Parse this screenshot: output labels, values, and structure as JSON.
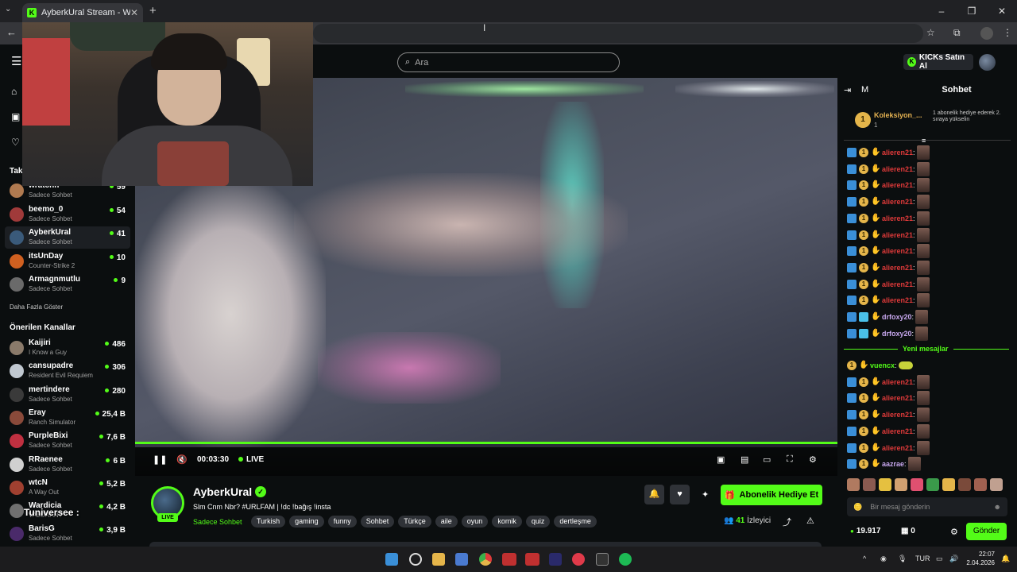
{
  "browser": {
    "tab_title": "AyberkUral Stream - Watch Live",
    "tab_favicon": "K",
    "new_tab": "+",
    "window_controls": [
      "–",
      "❐",
      "✕"
    ]
  },
  "header": {
    "search_placeholder": "Ara",
    "kicks_label": "KICKs Satın Al"
  },
  "sidebar": {
    "following_title": "Takip",
    "following": [
      {
        "name": "wratchn",
        "sub": "Sadece Sohbet",
        "viewers": "59",
        "color": "#b07a50"
      },
      {
        "name": "beemo_0",
        "sub": "Sadece Sohbet",
        "viewers": "54",
        "color": "#a03a3a"
      },
      {
        "name": "AyberkUral",
        "sub": "Sadece Sohbet",
        "viewers": "41",
        "color": "#3a5a7a"
      },
      {
        "name": "itsUnDay",
        "sub": "Counter-Strike 2",
        "viewers": "10",
        "color": "#d06020"
      },
      {
        "name": "Armagnmutlu",
        "sub": "Sadece Sohbet",
        "viewers": "9",
        "color": "#6a6a6a"
      }
    ],
    "show_more": "Daha Fazla Göster",
    "recommended_title": "Önerilen Kanallar",
    "recommended": [
      {
        "name": "Kaijiri",
        "sub": "I Know a Guy",
        "viewers": "486",
        "color": "#8a7a6a"
      },
      {
        "name": "cansupadre",
        "sub": "Resident Evil Requiem",
        "viewers": "306",
        "color": "#c0c8d0"
      },
      {
        "name": "mertindere",
        "sub": "Sadece Sohbet",
        "viewers": "280",
        "color": "#3a3a3a"
      },
      {
        "name": "Eray",
        "sub": "Ranch Simulator",
        "viewers": "25,4 B",
        "color": "#8a4a3a"
      },
      {
        "name": "PurpleBixi",
        "sub": "Sadece Sohbet",
        "viewers": "7,6 B",
        "color": "#c03040"
      },
      {
        "name": "RRaenee",
        "sub": "Sadece Sohbet",
        "viewers": "6 B",
        "color": "#d0d0d0"
      },
      {
        "name": "wtcN",
        "sub": "A Way Out",
        "viewers": "5,2 B",
        "color": "#a04030"
      },
      {
        "name": "Wardicia",
        "sub": "VALORANT",
        "viewers": "4,2 B",
        "color": "#707070"
      },
      {
        "name": "BarisG",
        "sub": "Sadece Sohbet",
        "viewers": "3,9 B",
        "color": "#4a2a6a"
      }
    ]
  },
  "overlay_text": "Tuniversee :",
  "player": {
    "time": "00:03:30",
    "live": "LIVE"
  },
  "stream": {
    "name": "AyberkUral",
    "title": "Slm Cnm Nbr? #URLFAM  | !dc !bağış !insta",
    "category": "Sadece Sohbet",
    "tags": [
      "Turkish",
      "gaming",
      "funny",
      "Sohbet",
      "Türkçe",
      "aile",
      "oyun",
      "komik",
      "quiz",
      "dertleşme"
    ],
    "live_badge": "LIVE",
    "gift_button": "Abonelik Hediye Et",
    "viewers_count": "41",
    "viewers_label": "İzleyici"
  },
  "chat": {
    "title": "Sohbet",
    "header_m": "M",
    "pinned_name": "Koleksiyon_...",
    "pinned_sub": "1",
    "pinned_rank": "1",
    "pinned_gift_text": "1 abonelik hediye ederek 2. sıraya yükselin",
    "new_messages": "Yeni mesajlar",
    "messages": [
      {
        "user": "alieren21",
        "color": "#e03a3a",
        "badges": [
          "b1",
          "b2",
          "b3"
        ],
        "emote": "face"
      },
      {
        "user": "alieren21",
        "color": "#e03a3a",
        "badges": [
          "b1",
          "b2",
          "b3"
        ],
        "emote": "face"
      },
      {
        "user": "alieren21",
        "color": "#e03a3a",
        "badges": [
          "b1",
          "b2",
          "b3"
        ],
        "emote": "face"
      },
      {
        "user": "alieren21",
        "color": "#e03a3a",
        "badges": [
          "b1",
          "b2",
          "b3"
        ],
        "emote": "face"
      },
      {
        "user": "alieren21",
        "color": "#e03a3a",
        "badges": [
          "b1",
          "b2",
          "b3"
        ],
        "emote": "face"
      },
      {
        "user": "alieren21",
        "color": "#e03a3a",
        "badges": [
          "b1",
          "b2",
          "b3"
        ],
        "emote": "face"
      },
      {
        "user": "alieren21",
        "color": "#e03a3a",
        "badges": [
          "b1",
          "b2",
          "b3"
        ],
        "emote": "face"
      },
      {
        "user": "alieren21",
        "color": "#e03a3a",
        "badges": [
          "b1",
          "b2",
          "b3"
        ],
        "emote": "face"
      },
      {
        "user": "alieren21",
        "color": "#e03a3a",
        "badges": [
          "b1",
          "b2",
          "b3"
        ],
        "emote": "face"
      },
      {
        "user": "alieren21",
        "color": "#e03a3a",
        "badges": [
          "b1",
          "b2",
          "b3"
        ],
        "emote": "face"
      },
      {
        "user": "drfoxy20",
        "color": "#c8a8f0",
        "badges": [
          "b1",
          "b4",
          "b3"
        ],
        "emote": "face"
      },
      {
        "user": "drfoxy20",
        "color": "#c8a8f0",
        "badges": [
          "b1",
          "b4",
          "b3"
        ],
        "emote": "face"
      }
    ],
    "messages_new": [
      {
        "user": "vuencx",
        "color": "#53fc18",
        "badges": [
          "b2",
          "b3"
        ],
        "emote": "frog"
      },
      {
        "user": "alieren21",
        "color": "#e03a3a",
        "badges": [
          "b1",
          "b2",
          "b3"
        ],
        "emote": "face"
      },
      {
        "user": "alieren21",
        "color": "#e03a3a",
        "badges": [
          "b1",
          "b2",
          "b3"
        ],
        "emote": "face"
      },
      {
        "user": "alieren21",
        "color": "#e03a3a",
        "badges": [
          "b1",
          "b2",
          "b3"
        ],
        "emote": "face"
      },
      {
        "user": "alieren21",
        "color": "#e03a3a",
        "badges": [
          "b1",
          "b2",
          "b3"
        ],
        "emote": "face"
      },
      {
        "user": "alieren21",
        "color": "#e03a3a",
        "badges": [
          "b1",
          "b2",
          "b3"
        ],
        "emote": "face"
      },
      {
        "user": "aazrae",
        "color": "#c8a8f0",
        "badges": [
          "b1",
          "b2",
          "b3"
        ],
        "emote": "face"
      }
    ],
    "input_placeholder": "Bir mesaj gönderin",
    "points": "19.917",
    "count": "0",
    "send_label": "Gönder"
  },
  "taskbar": {
    "lang": "TUR",
    "time": "22:07",
    "date": "2.04.2026"
  },
  "colors": {
    "accent": "#53fc18",
    "bg": "#0b0e0f"
  }
}
